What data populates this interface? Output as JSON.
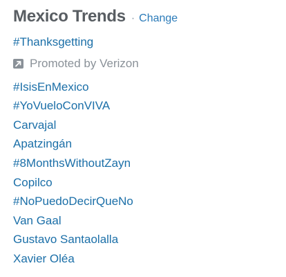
{
  "header": {
    "title": "Mexico Trends",
    "separator": "·",
    "change_label": "Change"
  },
  "promoted": {
    "hashtag": "#Thanksgetting",
    "label": "Promoted by Verizon",
    "icon": "promoted-arrow-icon"
  },
  "trends": [
    "#IsisEnMexico",
    "#YoVueloConVIVA",
    "Carvajal",
    "Apatzingán",
    "#8MonthsWithoutZayn",
    "Copilco",
    "#NoPuedoDecirQueNo",
    "Van Gaal",
    "Gustavo Santaolalla",
    "Xavier Oléa"
  ],
  "colors": {
    "title": "#585d62",
    "link": "#1b6fa8",
    "change": "#2b7bb9",
    "muted": "#8a9198"
  }
}
